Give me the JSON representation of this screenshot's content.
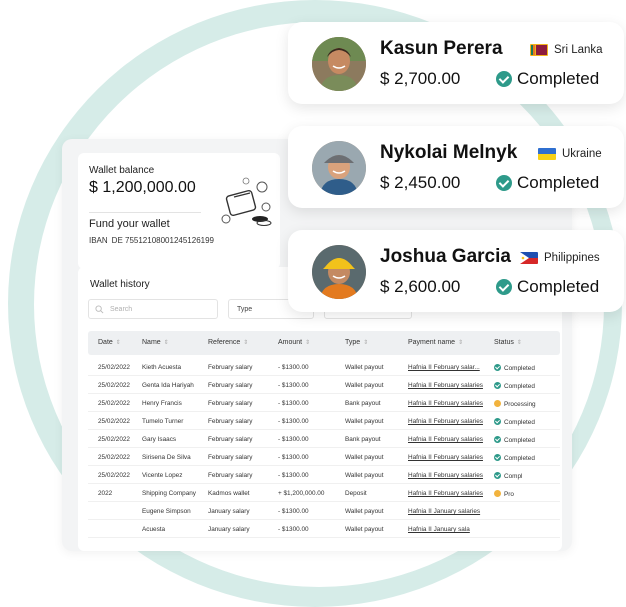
{
  "wallet": {
    "balance_label": "Wallet balance",
    "balance_amount": "$ 1,200,000.00",
    "fund_title": "Fund your wallet",
    "iban_label": "IBAN",
    "iban_value": "DE 75512108001245126199"
  },
  "history": {
    "title": "Wallet history",
    "search_placeholder": "Search",
    "filter_type": "Type",
    "columns": [
      "Date",
      "Name",
      "Reference",
      "Amount",
      "Type",
      "Payment name",
      "Status"
    ],
    "rows": [
      [
        "25/02/2022",
        "Kieth Acuesta",
        "February salary",
        "- $1300.00",
        "Wallet payout",
        "Hafnia II February salar...",
        "Completed"
      ],
      [
        "25/02/2022",
        "Genta Ida Hariyah",
        "February salary",
        "- $1300.00",
        "Wallet payout",
        "Hafnia II February salaries",
        "Completed"
      ],
      [
        "25/02/2022",
        "Henry Francis",
        "February salary",
        "- $1300.00",
        "Bank payout",
        "Hafnia II February salaries",
        "Processing"
      ],
      [
        "25/02/2022",
        "Tumelo Turner",
        "February salary",
        "- $1300.00",
        "Wallet payout",
        "Hafnia II February salaries",
        "Completed"
      ],
      [
        "25/02/2022",
        "Gary Isaacs",
        "February salary",
        "- $1300.00",
        "Bank payout",
        "Hafnia II February salaries",
        "Completed"
      ],
      [
        "25/02/2022",
        "Sirisena De Silva",
        "February salary",
        "- $1300.00",
        "Wallet payout",
        "Hafnia II February salaries",
        "Completed"
      ],
      [
        "25/02/2022",
        "Vicente Lopez",
        "February salary",
        "- $1300.00",
        "Wallet payout",
        "Hafnia II February salaries",
        "Compl"
      ],
      [
        "2022",
        "Shipping Company",
        "Kadmos wallet",
        "+ $1,200,000.00",
        "Deposit",
        "Hafnia II February salaries",
        "Pro"
      ],
      [
        "",
        "Eugene Simpson",
        "January salary",
        "- $1300.00",
        "Wallet payout",
        "Hafnia II January salaries",
        ""
      ],
      [
        "",
        "Acuesta",
        "January salary",
        "- $1300.00",
        "Wallet payout",
        "Hafnia II January sala",
        ""
      ]
    ],
    "row_status_kind": [
      "ok",
      "ok",
      "pend",
      "ok",
      "ok",
      "ok",
      "ok",
      "pend",
      "",
      ""
    ]
  },
  "payouts": [
    {
      "name": "Kasun Perera",
      "amount": "$ 2,700.00",
      "country": "Sri Lanka",
      "status": "Completed",
      "flag_icon": "sri-lanka-flag-icon"
    },
    {
      "name": "Nykolai Melnyk",
      "amount": "$ 2,450.00",
      "country": "Ukraine",
      "status": "Completed",
      "flag_icon": "ukraine-flag-icon"
    },
    {
      "name": "Joshua Garcia",
      "amount": "$ 2,600.00",
      "country": "Philippines",
      "status": "Completed",
      "flag_icon": "philippines-flag-icon"
    }
  ],
  "colors": {
    "accent": "#2e9a8a",
    "ring": "#d6ece8",
    "pending": "#f2b33d"
  }
}
